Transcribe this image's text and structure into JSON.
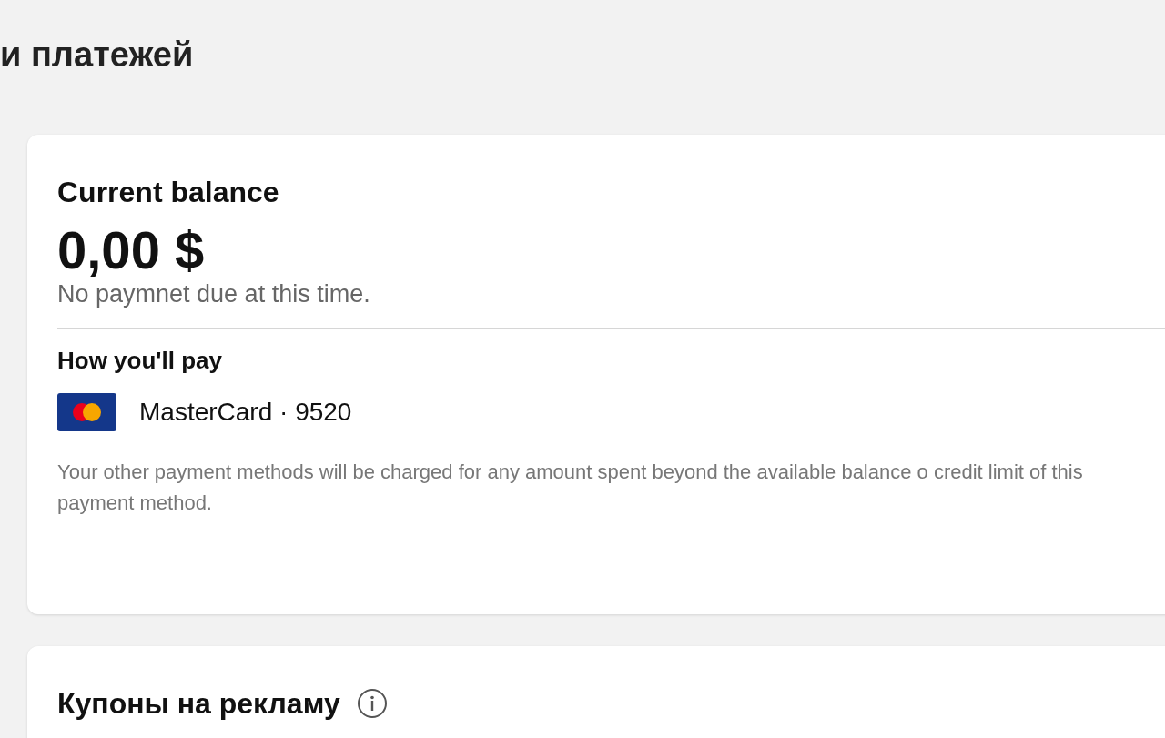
{
  "page_title": "и платежей",
  "balance_card": {
    "title": "Current balance",
    "amount": "0,00 $",
    "status": "No paymnet due at this time.",
    "pay_heading": "How you'll pay",
    "payment_method": "MasterCard · 9520",
    "note": "Your other payment methods will be charged for any amount spent beyond the available balance o credit limit of this payment method."
  },
  "coupons_card": {
    "title": "Купоны на рекламу"
  }
}
